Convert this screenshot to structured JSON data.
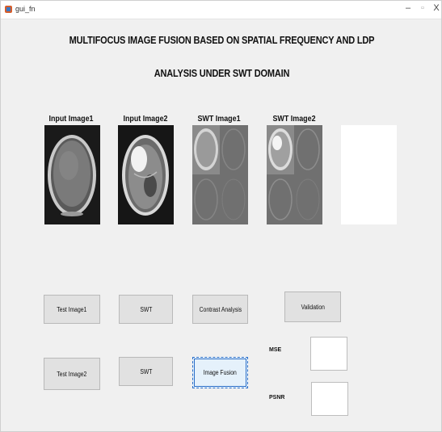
{
  "window": {
    "title": "gui_fn",
    "minimize": "–",
    "maximize": "▫",
    "close": "X"
  },
  "header": {
    "line1": "MULTIFOCUS IMAGE FUSION BASED ON SPATIAL FREQUENCY AND LDP",
    "line2": "ANALYSIS  UNDER SWT DOMAIN"
  },
  "images": {
    "input1_label": "Input Image1",
    "input2_label": "Input Image2",
    "swt1_label": "SWT Image1",
    "swt2_label": "SWT Image2"
  },
  "buttons": {
    "test_image1": "Test Image1",
    "swt1": "SWT",
    "contrast_analysis": "Contrast Analysis",
    "validation": "Validation",
    "test_image2": "Test Image2",
    "swt2": "SWT",
    "image_fusion": "Image Fusion"
  },
  "metrics": {
    "mse_label": "MSE",
    "mse_value": "",
    "psnr_label": "PSNR",
    "psnr_value": ""
  }
}
